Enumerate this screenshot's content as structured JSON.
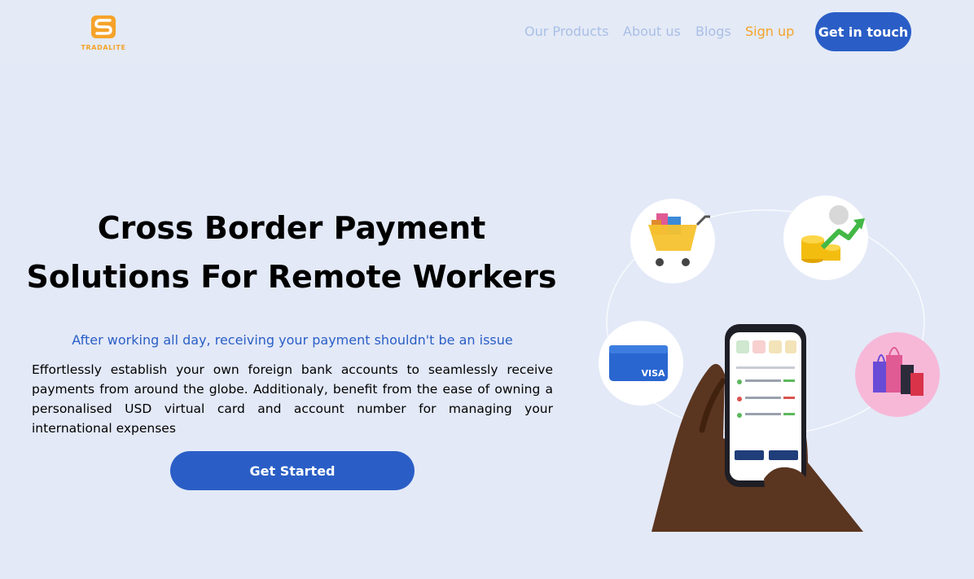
{
  "brand": {
    "name": "TRADALITE",
    "accent_color": "#f5a32a",
    "logo_icon": "tradalite-logo-icon"
  },
  "nav": {
    "products": "Our Products",
    "about": "About us",
    "blogs": "Blogs",
    "signup": "Sign up",
    "cta": "Get in touch"
  },
  "hero": {
    "title_line1": "Cross Border Payment",
    "title_line2": "Solutions For Remote Workers",
    "subtitle": "After working all day, receiving your payment shouldn't be an issue",
    "description": "Effortlessly establish your own foreign bank accounts to seamlessly receive payments from around the globe. Additionaly, benefit from the ease of owning a personalised USD virtual card and account number for managing your international expenses",
    "cta": "Get Started"
  },
  "illustration": {
    "card_brand": "VISA",
    "icons": [
      "shopping-cart-icon",
      "coins-growth-icon",
      "visa-card-icon",
      "shopping-bags-icon",
      "phone-in-hand-icon"
    ]
  },
  "colors": {
    "primary": "#2a5ec6",
    "background": "#e3e9f7",
    "nav_text": "#a9bfe6"
  }
}
